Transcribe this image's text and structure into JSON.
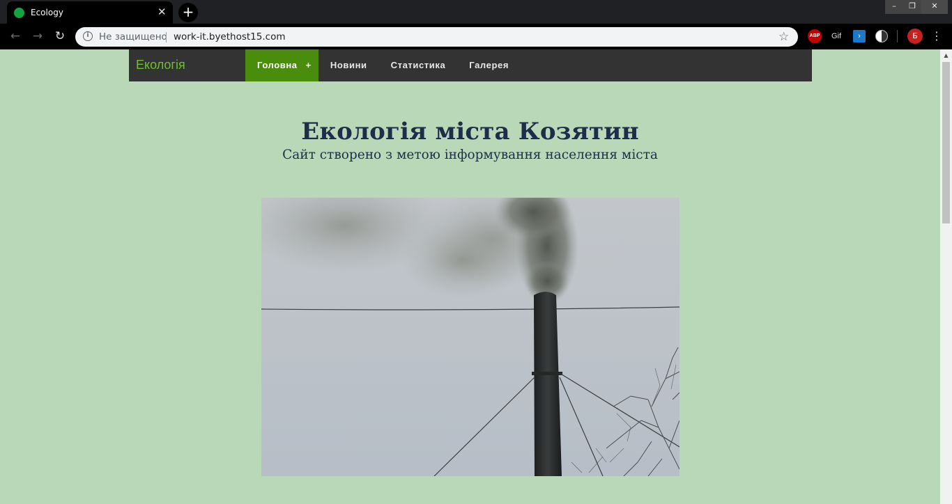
{
  "browser": {
    "tab_title": "Ecology",
    "tab_close": "✕",
    "new_tab": "+",
    "window_controls": {
      "minimize": "–",
      "maximize": "❐",
      "close": "✕"
    },
    "nav": {
      "back": "←",
      "forward": "→",
      "reload": "↻"
    },
    "security_label": "Не защищено",
    "url": "work-it.byethost15.com",
    "bookmark_icon": "☆",
    "extensions": {
      "abp": "ABP",
      "gif": "Gif",
      "arrow": "›"
    },
    "profile_initial": "Б",
    "menu_icon": "⋮",
    "favicon_color": "#12a342"
  },
  "site": {
    "brand": "Екологія",
    "menu": [
      {
        "label": "Головна",
        "active": true,
        "suffix": "+"
      },
      {
        "label": "Новини",
        "active": false
      },
      {
        "label": "Статистика",
        "active": false
      },
      {
        "label": "Галерея",
        "active": false
      }
    ],
    "colors": {
      "background": "#b8d8b8",
      "nav": "#333333",
      "active": "#4a8c0b",
      "brand": "#6ac32a",
      "heading": "#1e2e4a"
    }
  },
  "hero": {
    "title": "Екологія міста Козятин",
    "subtitle": "Сайт створено з метою інформування населення міста"
  },
  "photo": {
    "subject": "smokestack-photo"
  }
}
